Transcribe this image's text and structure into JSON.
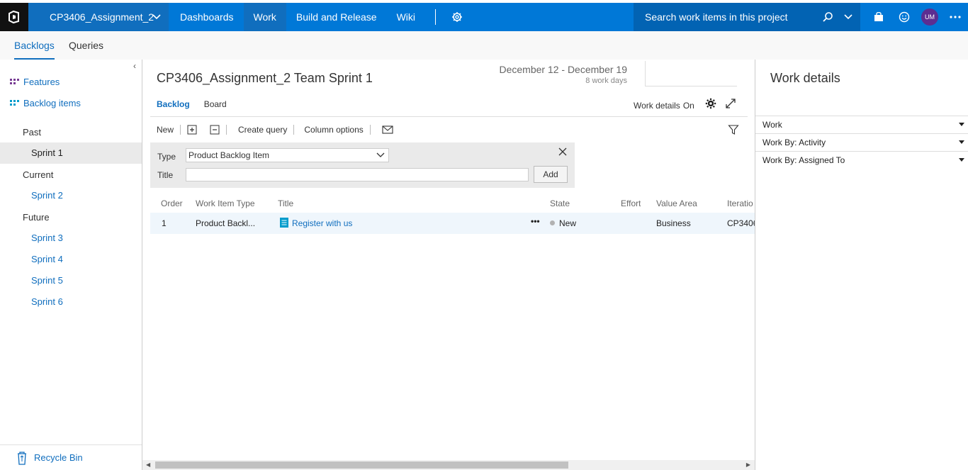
{
  "topbar": {
    "project": "CP3406_Assignment_2",
    "nav": [
      "Dashboards",
      "Work",
      "Build and Release",
      "Wiki"
    ],
    "active_nav": "Work",
    "search_placeholder": "Search work items in this project",
    "avatar_initials": "UM",
    "brand_color": "#0078d7"
  },
  "subnav": {
    "tabs": [
      "Backlogs",
      "Queries"
    ],
    "active": "Backlogs"
  },
  "leftpane": {
    "collapse_glyph": "‹",
    "backlogs": [
      "Features",
      "Backlog items"
    ],
    "groups": {
      "past": "Past",
      "current": "Current",
      "future": "Future"
    },
    "sprints": {
      "past": [
        "Sprint 1"
      ],
      "current": [
        "Sprint 2"
      ],
      "future": [
        "Sprint 3",
        "Sprint 4",
        "Sprint 5",
        "Sprint 6"
      ]
    },
    "selected_sprint": "Sprint 1",
    "recycle_bin": "Recycle Bin"
  },
  "main": {
    "sprint_title": "CP3406_Assignment_2 Team Sprint 1",
    "date_range": "December 12 - December 19",
    "work_days": "8 work days",
    "pivots": [
      "Backlog",
      "Board"
    ],
    "active_pivot": "Backlog",
    "work_details_label": "Work details",
    "work_details_state": "On",
    "toolbar": {
      "new": "New",
      "create_query": "Create query",
      "column_options": "Column options"
    },
    "add_panel": {
      "type_label": "Type",
      "type_value": "Product Backlog Item",
      "title_label": "Title",
      "title_value": "",
      "add_button": "Add"
    },
    "grid": {
      "columns": [
        "Order",
        "Work Item Type",
        "Title",
        "State",
        "Effort",
        "Value Area",
        "Iteratio"
      ],
      "rows": [
        {
          "order": "1",
          "type": "Product Backl...",
          "title": "Register with us",
          "more": "•••",
          "state": "New",
          "effort": "",
          "value_area": "Business",
          "iteration": "CP3406"
        }
      ]
    }
  },
  "rightpane": {
    "title": "Work details",
    "sections": [
      "Work",
      "Work By: Activity",
      "Work By: Assigned To"
    ]
  }
}
